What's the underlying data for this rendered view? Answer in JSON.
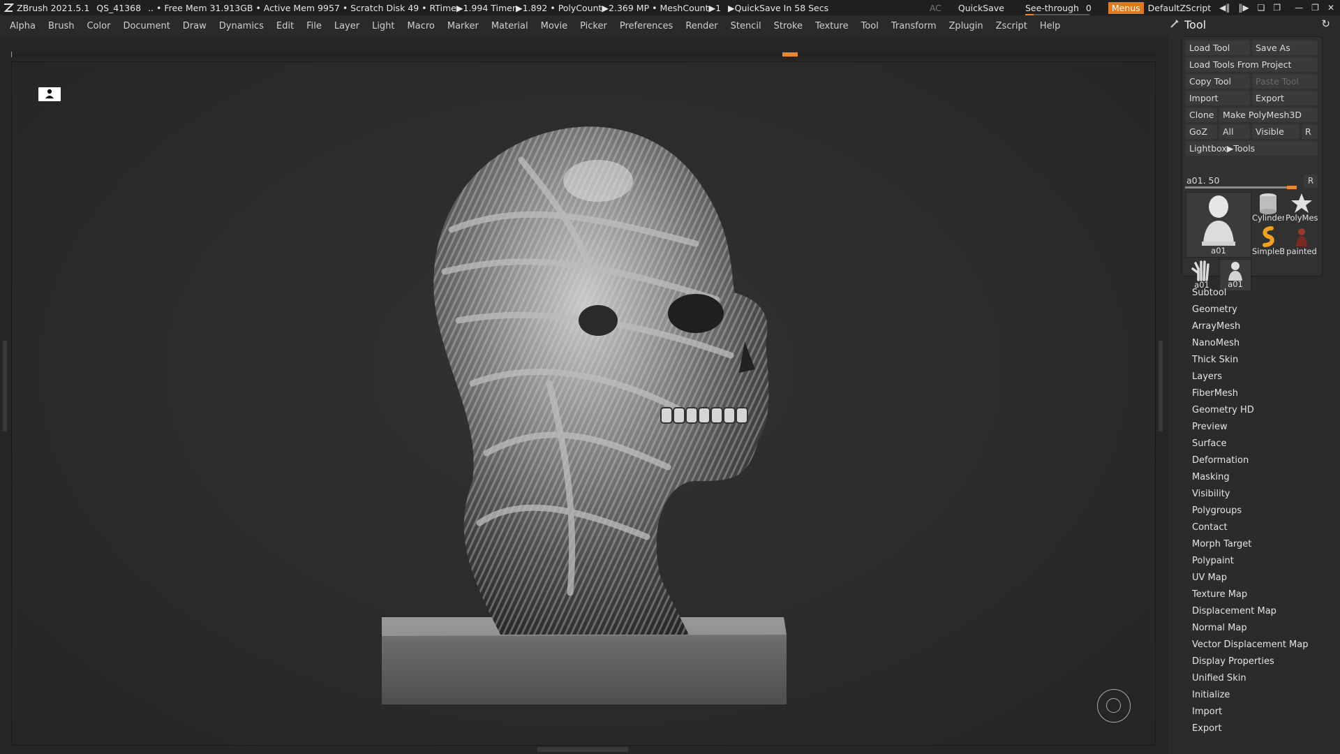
{
  "titlebar": {
    "app": "ZBrush 2021.5.1",
    "project": "QS_41368",
    "stats": ".. • Free Mem 31.913GB • Active Mem 9957 • Scratch Disk 49 •  RTime▶1.994 Timer▶1.892 • PolyCount▶2.369 MP  • MeshCount▶1",
    "quicksave_status": "▶QuickSave In 58 Secs",
    "ac": "AC",
    "quicksave": "QuickSave",
    "see_through_label": "See-through",
    "see_through_value": "0",
    "see_through_level": 0,
    "menus": "Menus",
    "script": "DefaultZScript"
  },
  "menubar": {
    "items": [
      "Alpha",
      "Brush",
      "Color",
      "Document",
      "Draw",
      "Dynamics",
      "Edit",
      "File",
      "Layer",
      "Light",
      "Macro",
      "Marker",
      "Material",
      "Movie",
      "Picker",
      "Preferences",
      "Render",
      "Stencil",
      "Stroke",
      "Texture",
      "Tool",
      "Transform",
      "Zplugin",
      "Zscript",
      "Help"
    ]
  },
  "tool_panel": {
    "title": "Tool",
    "buttons": {
      "load_tool": "Load Tool",
      "save_as": "Save As",
      "load_from_project": "Load Tools From Project",
      "copy_tool": "Copy Tool",
      "paste_tool": "Paste Tool",
      "import": "Import",
      "export": "Export",
      "clone": "Clone",
      "make_polymesh": "Make PolyMesh3D",
      "goz": "GoZ",
      "all": "All",
      "visible": "Visible",
      "r": "R",
      "lightbox": "Lightbox▶Tools"
    },
    "slider": {
      "label": "a01. 50",
      "value": 50,
      "max": 50
    },
    "thumbs": {
      "current": "a01",
      "cylinder": "Cylinder",
      "polymesh": "PolyMes",
      "simpleb": "SimpleB",
      "painted": "painted",
      "hand": "a01",
      "bust": "a01"
    },
    "subpalettes": [
      "Subtool",
      "Geometry",
      "ArrayMesh",
      "NanoMesh",
      "Thick Skin",
      "Layers",
      "FiberMesh",
      "Geometry HD",
      "Preview",
      "Surface",
      "Deformation",
      "Masking",
      "Visibility",
      "Polygroups",
      "Contact",
      "Morph Target",
      "Polypaint",
      "UV Map",
      "Texture Map",
      "Displacement Map",
      "Normal Map",
      "Vector Displacement Map",
      "Display Properties",
      "Unified Skin",
      "Initialize",
      "Import",
      "Export"
    ]
  },
  "colors": {
    "accent": "#e88a2b",
    "background": "#262626",
    "panel": "#2b2b2b"
  }
}
